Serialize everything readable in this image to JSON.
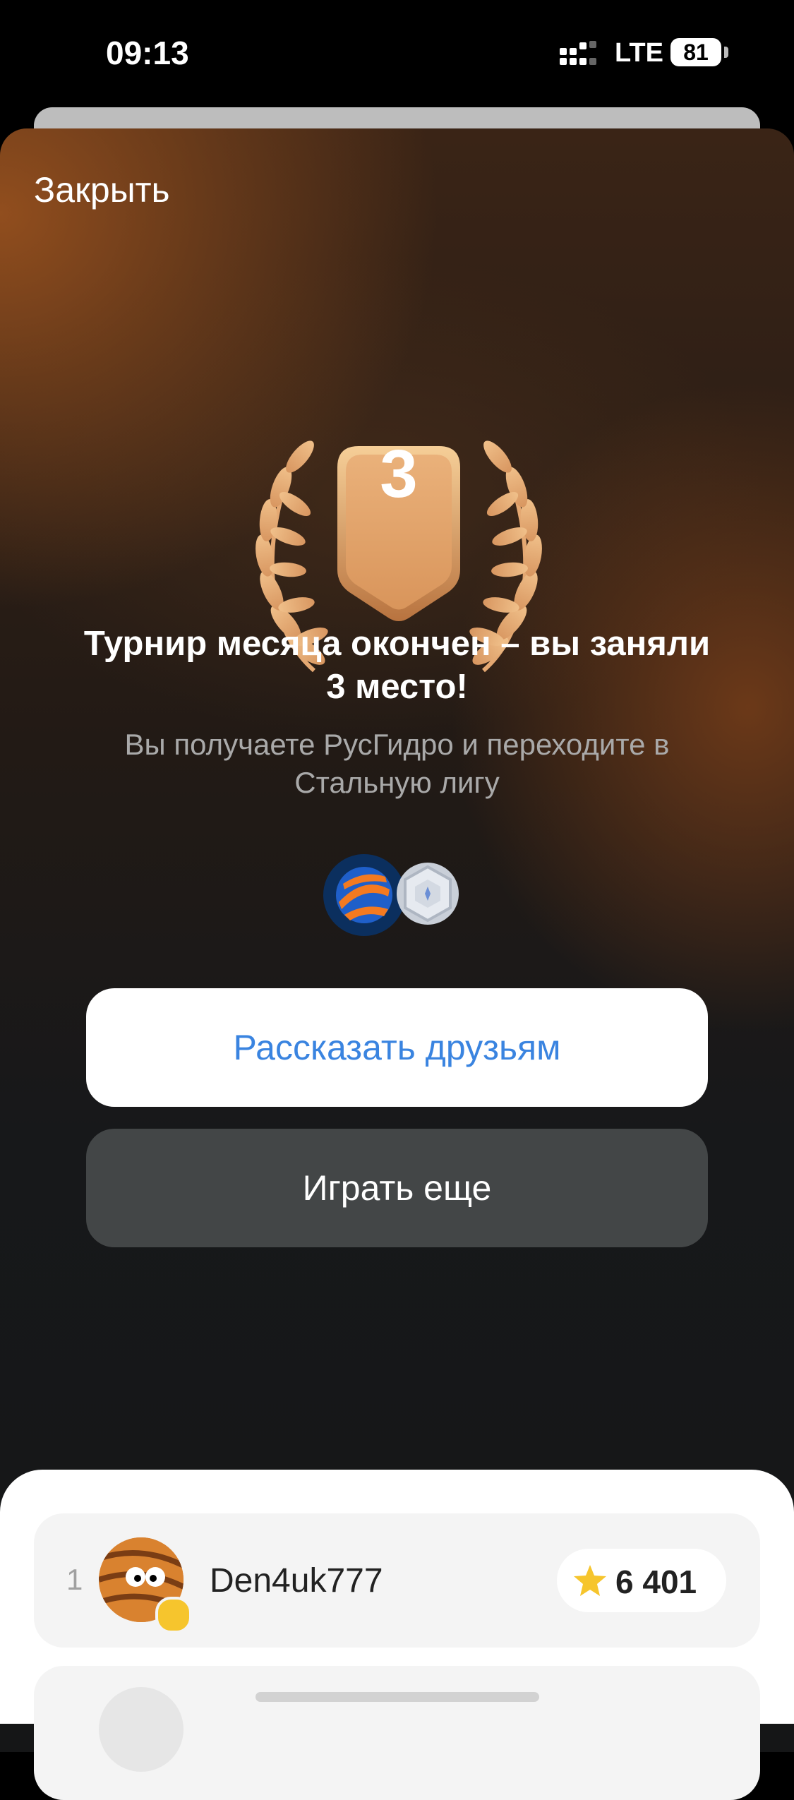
{
  "status_bar": {
    "time": "09:13",
    "network": "LTE",
    "battery": "81"
  },
  "modal": {
    "close_label": "Закрыть",
    "place_number": "3",
    "headline": "Турнир месяца окончен – вы заняли 3 место!",
    "subline": "Вы получаете РусГидро и переходите в Стальную лигу",
    "rewards": [
      "rushydro-logo-icon",
      "steel-league-badge-icon"
    ],
    "share_label": "Рассказать друзьям",
    "play_label": "Играть еще"
  },
  "leaderboard": {
    "rows": [
      {
        "rank": "1",
        "name": "Den4uk777",
        "score": "6 401"
      }
    ]
  },
  "colors": {
    "accent_blue": "#3a84e0",
    "bronze": "#e0a86a",
    "star": "#f6c52d"
  }
}
